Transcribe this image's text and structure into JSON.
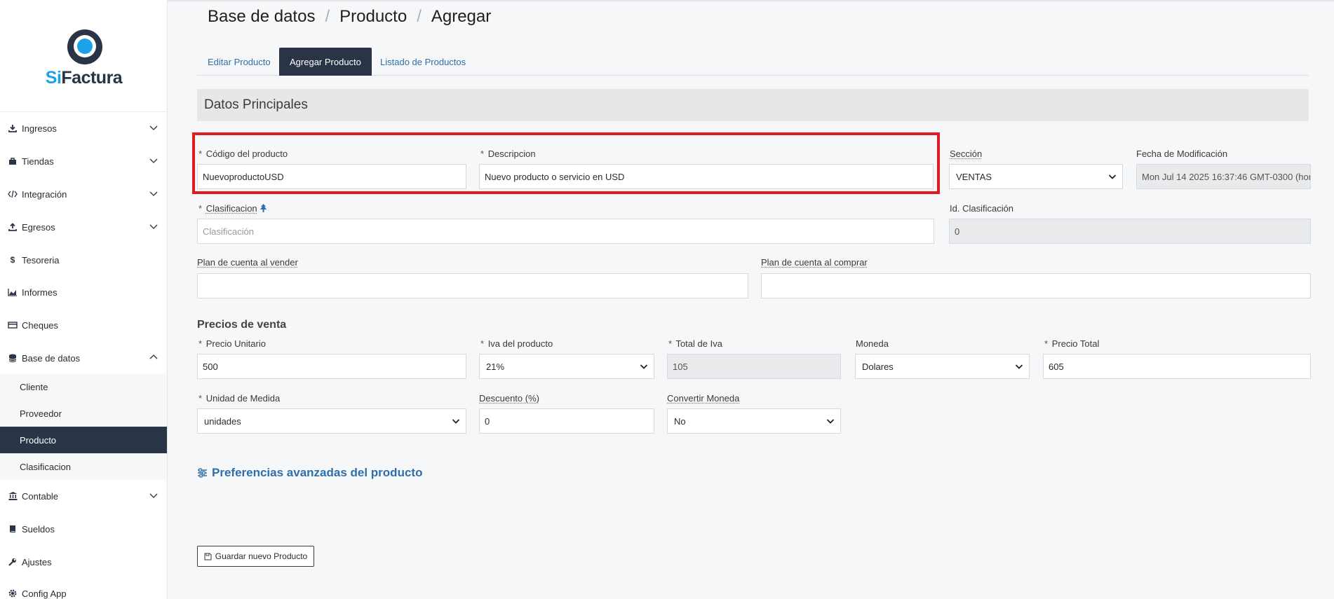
{
  "brand": {
    "si": "Si",
    "factura": "Factura"
  },
  "sidebar": {
    "items": [
      {
        "label": "Ingresos"
      },
      {
        "label": "Tiendas"
      },
      {
        "label": "Integración"
      },
      {
        "label": "Egresos"
      },
      {
        "label": "Tesoreria"
      },
      {
        "label": "Informes"
      },
      {
        "label": "Cheques"
      },
      {
        "label": "Base de datos"
      },
      {
        "label": "Contable"
      },
      {
        "label": "Sueldos"
      },
      {
        "label": "Ajustes"
      },
      {
        "label": "Config App"
      }
    ],
    "subitems": [
      {
        "label": "Cliente"
      },
      {
        "label": "Proveedor"
      },
      {
        "label": "Producto"
      },
      {
        "label": "Clasificacion"
      }
    ]
  },
  "breadcrumb": {
    "p1": "Base de datos",
    "sep": "/",
    "p2": "Producto",
    "p3": "Agregar"
  },
  "tabs": [
    {
      "label": "Editar Producto"
    },
    {
      "label": "Agregar Producto"
    },
    {
      "label": "Listado de Productos"
    }
  ],
  "section": {
    "title": "Datos Principales"
  },
  "form": {
    "codigo": {
      "label": "Código del producto",
      "value": "NuevoproductoUSD"
    },
    "descripcion": {
      "label": "Descripcion",
      "value": "Nuevo producto o servicio en USD"
    },
    "seccion": {
      "label": "Sección",
      "value": "VENTAS"
    },
    "fecha": {
      "label": "Fecha de Modificación",
      "value": "Mon Jul 14 2025 16:37:46 GMT-0300 (hor"
    },
    "clasificacion": {
      "label": "Clasificacion",
      "placeholder": "Clasificación"
    },
    "id_clasificacion": {
      "label": "Id. Clasificación",
      "value": "0"
    },
    "plan_vender": {
      "label": "Plan de cuenta al vender",
      "value": ""
    },
    "plan_comprar": {
      "label": "Plan de cuenta al comprar",
      "value": ""
    }
  },
  "precios": {
    "title": "Precios de venta",
    "precio_unitario": {
      "label": "Precio Unitario",
      "value": "500"
    },
    "iva": {
      "label": "Iva del producto",
      "value": "21%"
    },
    "total_iva": {
      "label": "Total de Iva",
      "value": "105"
    },
    "moneda": {
      "label": "Moneda",
      "value": "Dolares"
    },
    "precio_total": {
      "label": "Precio Total",
      "value": "605"
    },
    "unidad": {
      "label": "Unidad de Medida",
      "value": "unidades"
    },
    "descuento": {
      "label": "Descuento (%)",
      "value": "0"
    },
    "convertir": {
      "label": "Convertir Moneda",
      "value": "No"
    }
  },
  "advanced": {
    "label": "Preferencias avanzadas del producto"
  },
  "save": {
    "label": "Guardar nuevo Producto"
  },
  "required_mark": "*",
  "colors": {
    "accent": "#2a3447",
    "link": "#2f6fa8",
    "brand_blue": "#1da1e8",
    "highlight": "#e01b22"
  }
}
